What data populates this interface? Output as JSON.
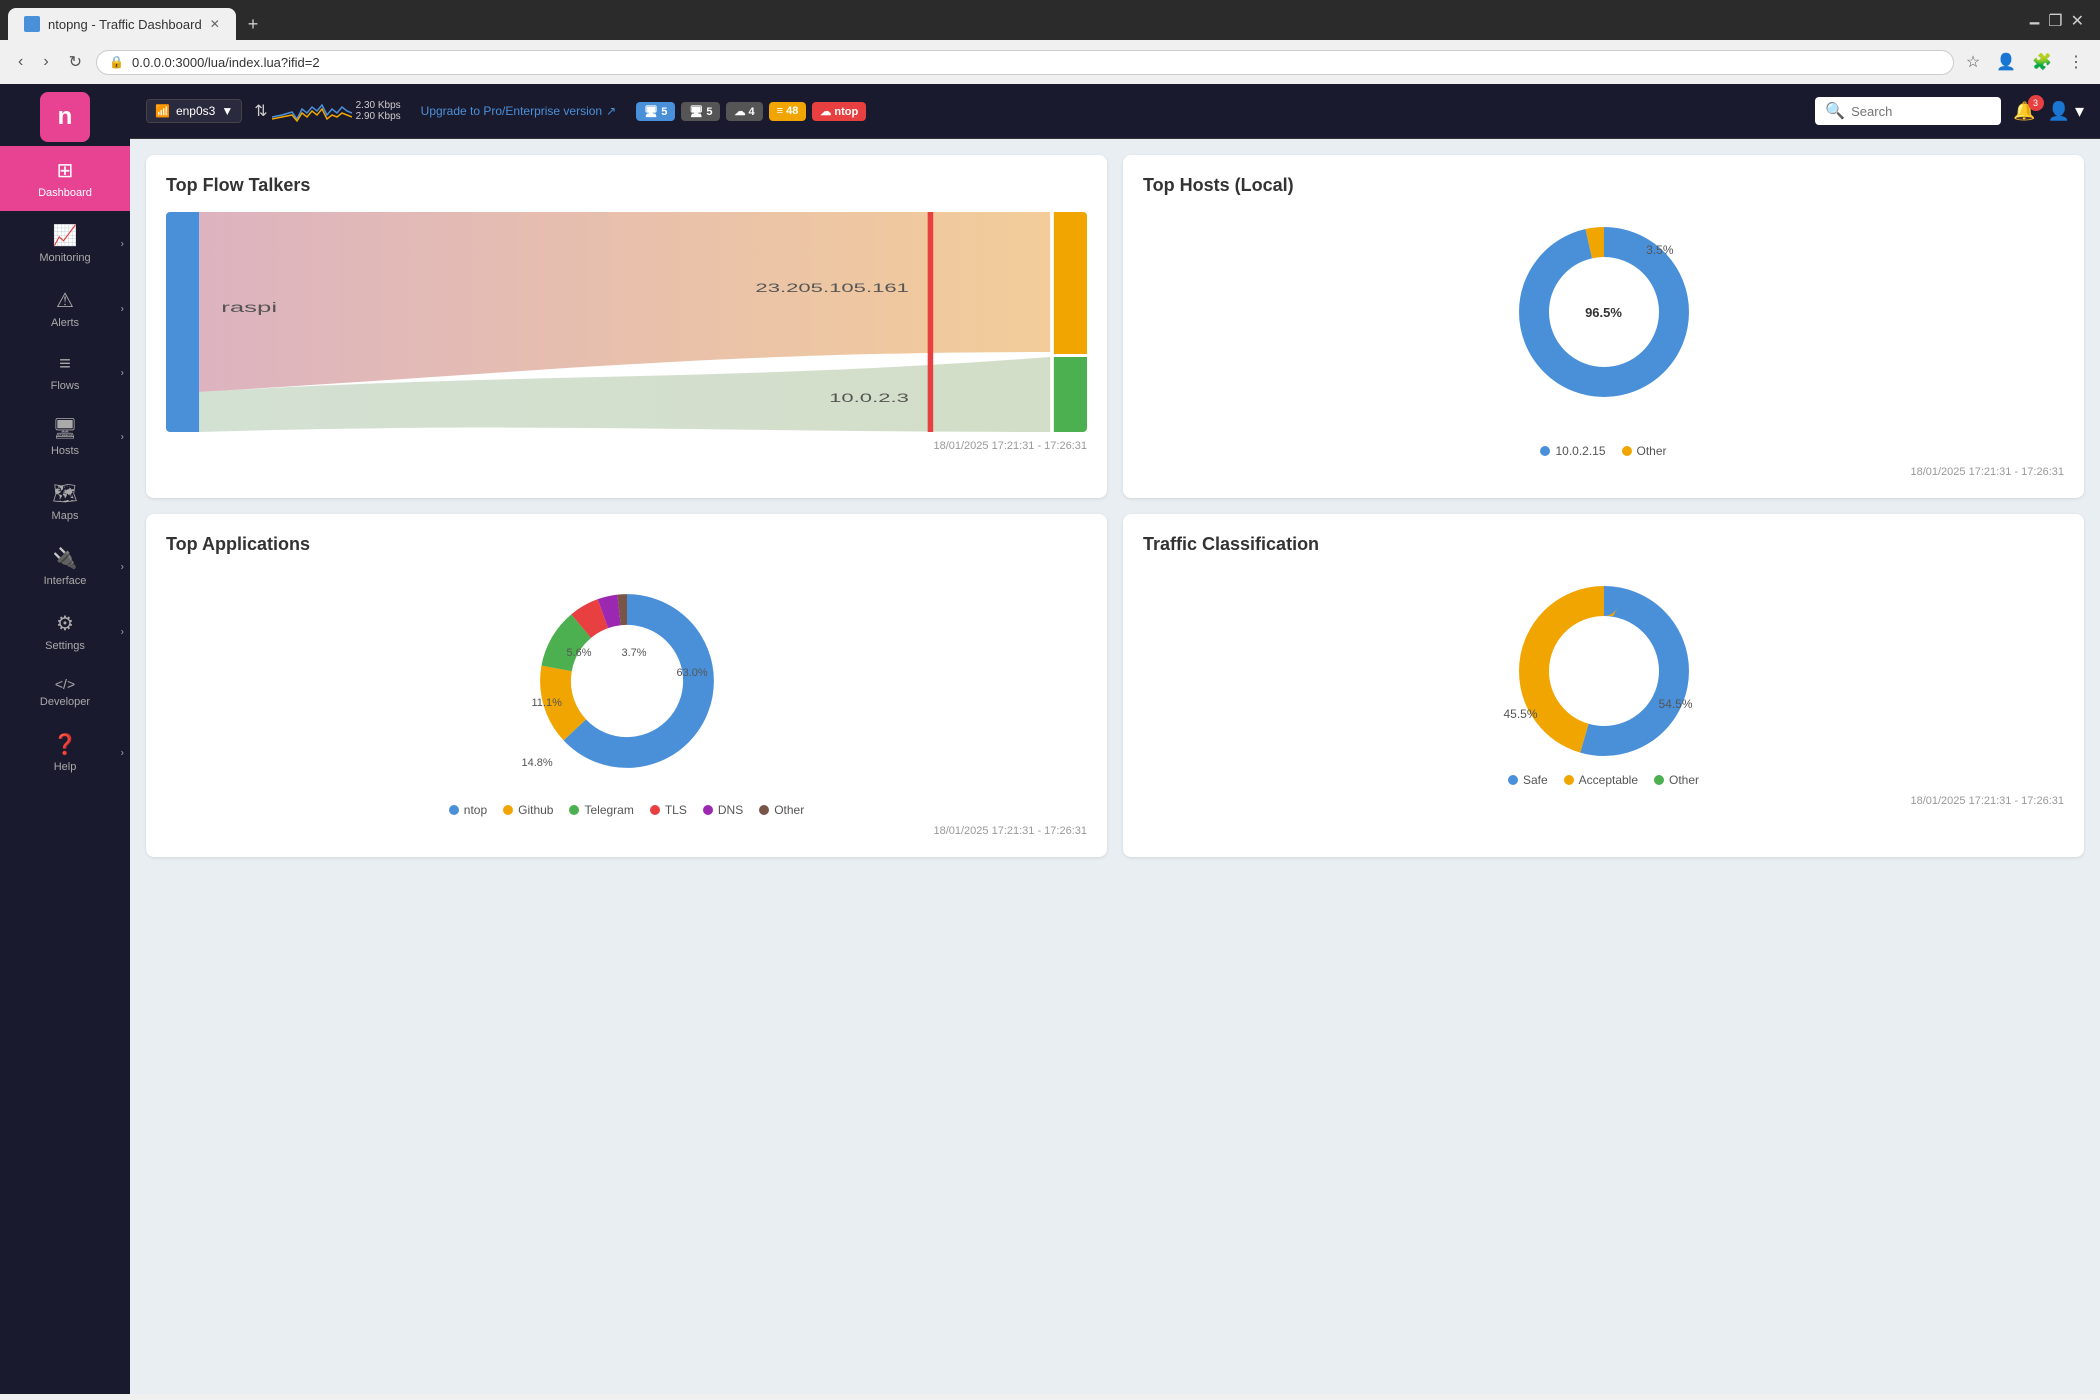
{
  "browser": {
    "tab_title": "ntopng - Traffic Dashboard",
    "address": "0.0.0.0:3000/lua/index.lua?ifid=2",
    "new_tab_label": "+"
  },
  "topbar": {
    "interface_name": "enp0s3",
    "traffic_up": "2.30 Kbps",
    "traffic_down": "2.90 Kbps",
    "upgrade_text": "Upgrade to Pro/Enterprise version",
    "badges": [
      {
        "label": "5",
        "icon": "🖥",
        "type": "blue"
      },
      {
        "label": "5",
        "icon": "🖥",
        "type": "gray"
      },
      {
        "label": "4",
        "icon": "☁",
        "type": "gray"
      },
      {
        "label": "48",
        "icon": "≡",
        "type": "orange"
      },
      {
        "label": "ntop",
        "icon": "☁",
        "type": "red"
      }
    ],
    "search_placeholder": "Search",
    "notification_count": "3"
  },
  "sidebar": {
    "logo": "n",
    "items": [
      {
        "label": "Dashboard",
        "icon": "⊞",
        "active": true
      },
      {
        "label": "Monitoring",
        "icon": "📊",
        "active": false
      },
      {
        "label": "Alerts",
        "icon": "⚠",
        "active": false
      },
      {
        "label": "Flows",
        "icon": "≡",
        "active": false
      },
      {
        "label": "Hosts",
        "icon": "🖥",
        "active": false
      },
      {
        "label": "Maps",
        "icon": "🗺",
        "active": false
      },
      {
        "label": "Interface",
        "icon": "🔌",
        "active": false
      },
      {
        "label": "Settings",
        "icon": "⚙",
        "active": false
      },
      {
        "label": "Developer",
        "icon": "</>",
        "active": false
      },
      {
        "label": "Help",
        "icon": "?",
        "active": false
      }
    ]
  },
  "cards": {
    "top_flow_talkers": {
      "title": "Top Flow Talkers",
      "timestamp": "18/01/2025 17:21:31 - 17:26:31",
      "left_label": "raspi",
      "right_labels": [
        "23.205.105.161",
        "10.0.2.3"
      ]
    },
    "top_hosts": {
      "title": "Top Hosts (Local)",
      "timestamp": "18/01/2025 17:21:31 - 17:26:31",
      "segments": [
        {
          "label": "10.0.2.15",
          "value": 96.5,
          "color": "#4a90d9"
        },
        {
          "label": "Other",
          "value": 3.5,
          "color": "#f0a500"
        }
      ],
      "center_label": "96.5%",
      "center_label2": "3.5%"
    },
    "top_applications": {
      "title": "Top Applications",
      "timestamp": "18/01/2025 17:21:31 - 17:26:31",
      "segments": [
        {
          "label": "ntop",
          "value": 63.0,
          "color": "#4a90d9"
        },
        {
          "label": "Github",
          "value": 14.8,
          "color": "#f0a500"
        },
        {
          "label": "Telegram",
          "value": 11.1,
          "color": "#4caf50"
        },
        {
          "label": "TLS",
          "value": 5.6,
          "color": "#e84040"
        },
        {
          "label": "DNS",
          "value": 3.7,
          "color": "#9c27b0"
        },
        {
          "label": "Other",
          "value": 1.8,
          "color": "#795548"
        }
      ],
      "labels": [
        "63.0%",
        "14.8%",
        "11.1%",
        "5.6%",
        "3.7%"
      ]
    },
    "traffic_classification": {
      "title": "Traffic Classification",
      "timestamp": "18/01/2025 17:21:31 - 17:26:31",
      "segments": [
        {
          "label": "Safe",
          "value": 54.5,
          "color": "#4a90d9"
        },
        {
          "label": "Acceptable",
          "value": 45.5,
          "color": "#f0a500"
        },
        {
          "label": "Other",
          "value": 0,
          "color": "#4caf50"
        }
      ],
      "labels": [
        "54.5%",
        "45.5%"
      ]
    }
  },
  "colors": {
    "sidebar_bg": "#1a1a2e",
    "sidebar_active": "#e84393",
    "topbar_bg": "#1a1a2e",
    "main_bg": "#e8eef2",
    "accent_teal": "#1a6b6b"
  }
}
